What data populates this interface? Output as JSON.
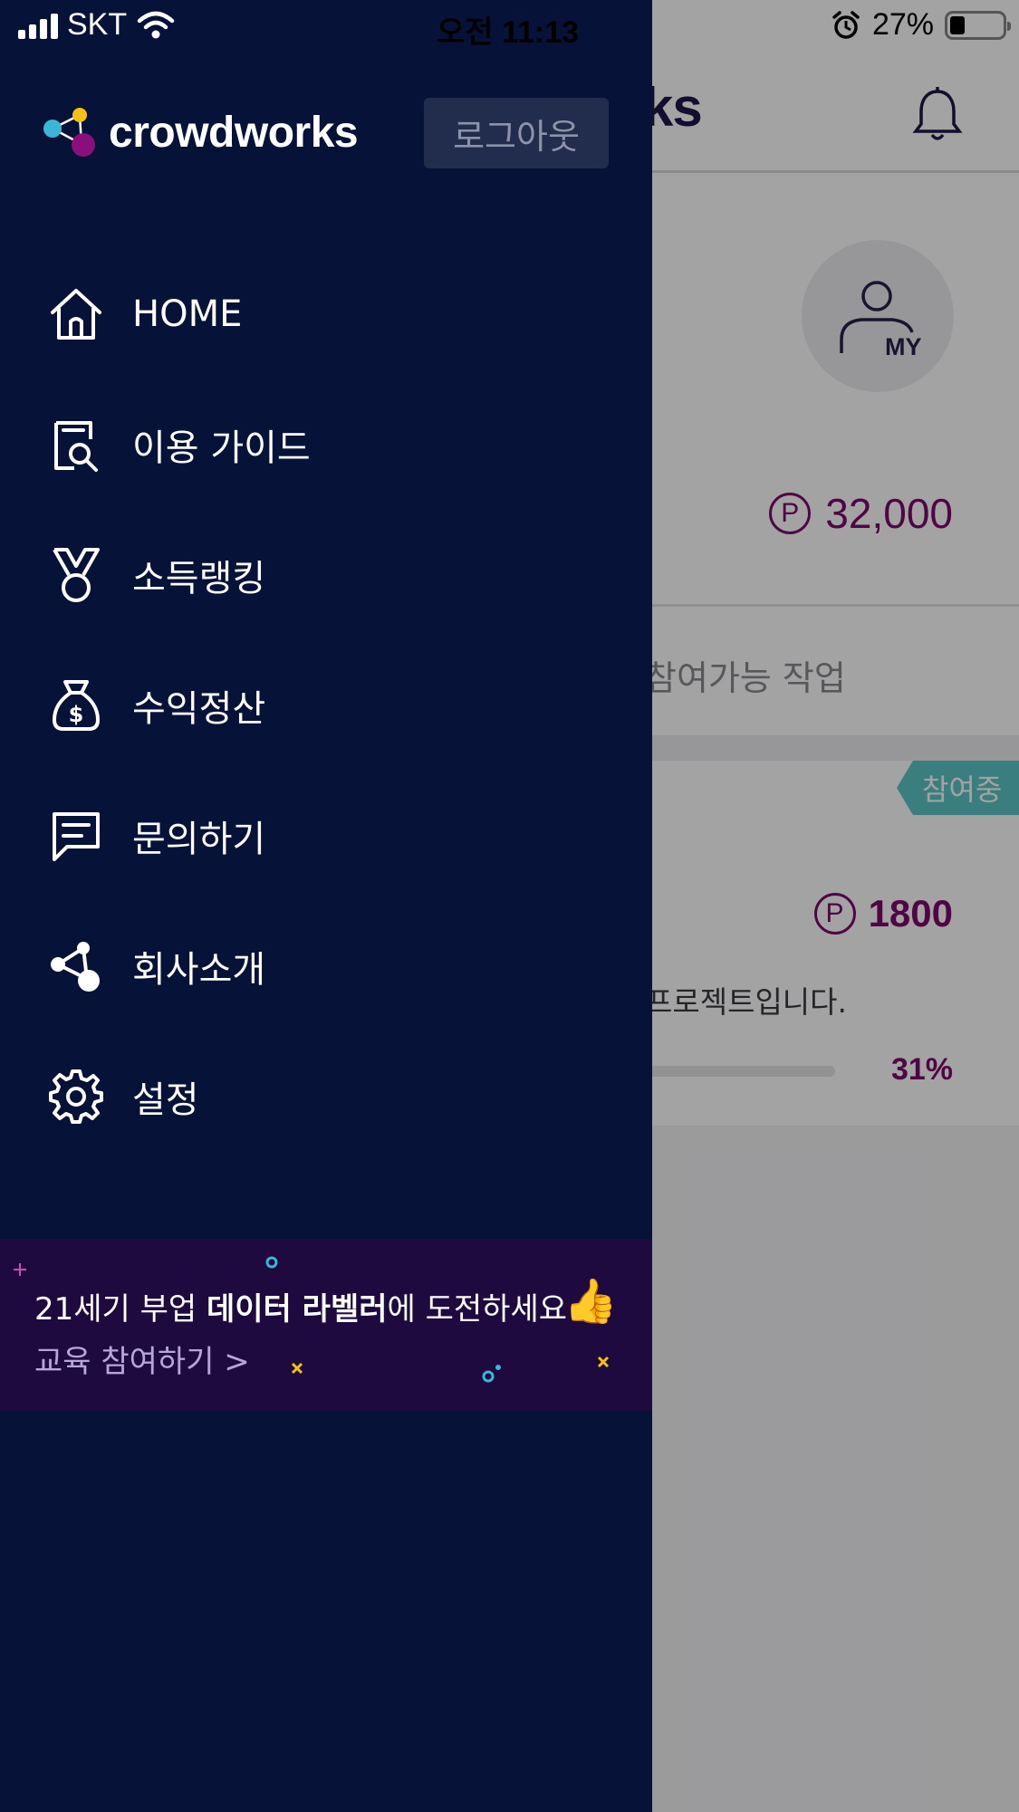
{
  "status_bar": {
    "carrier": "SKT",
    "time": "오전 11:13",
    "battery": "27%"
  },
  "drawer": {
    "logo_text": "crowdworks",
    "logout_label": "로그아웃",
    "menu": [
      {
        "label": "HOME",
        "icon": "home-icon"
      },
      {
        "label": "이용 가이드",
        "icon": "guide-icon"
      },
      {
        "label": "소득랭킹",
        "icon": "medal-icon"
      },
      {
        "label": "수익정산",
        "icon": "money-bag-icon"
      },
      {
        "label": "문의하기",
        "icon": "chat-icon"
      },
      {
        "label": "회사소개",
        "icon": "share-icon"
      },
      {
        "label": "설정",
        "icon": "gear-icon"
      }
    ],
    "promo": {
      "text_before": "21세기 부업 ",
      "text_bold": "데이터 라벨러",
      "text_after": "에 도전하세요",
      "emoji": "👍",
      "link": "교육 참여하기 >"
    }
  },
  "background": {
    "title_partial": "ks",
    "avatar_label": "MY",
    "points_symbol": "P",
    "points": "32,000",
    "available_label": "참여가능 작업",
    "badge": "참여중",
    "task_points": "1800",
    "task_desc": "프로젝트입니다.",
    "progress": "31%"
  },
  "colors": {
    "drawer_bg": "#061237",
    "accent_purple": "#7d0a6b",
    "badge_teal": "#5bc6c9"
  }
}
